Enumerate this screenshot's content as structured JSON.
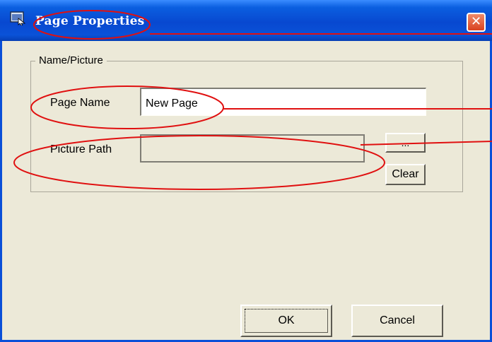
{
  "window": {
    "title": "Page Properties",
    "icon": "page-window-icon",
    "close_glyph": "✕"
  },
  "group": {
    "label": "Name/Picture"
  },
  "page_name": {
    "label": "Page Name",
    "value": "New Page"
  },
  "picture_path": {
    "label": "Picture Path",
    "value": "",
    "browse_label": "...",
    "clear_label": "Clear"
  },
  "buttons": {
    "ok_label": "OK",
    "cancel_label": "Cancel"
  },
  "annotation_color": "#e01010"
}
